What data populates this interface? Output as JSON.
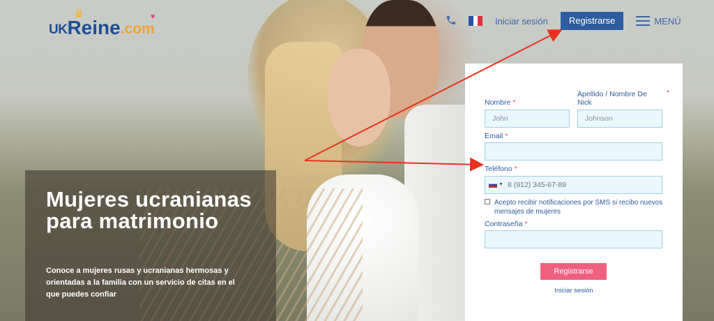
{
  "header": {
    "logo": {
      "uk": "UK",
      "reine": "Reine",
      "com": ".com"
    },
    "login_label": "Iniciar sesión",
    "register_label": "Registrarse",
    "menu_label": "MENÚ"
  },
  "hero": {
    "title": "Mujeres ucranianas para matrimonio",
    "description": "Conoce a mujeres rusas y ucranianas hermosas y orientadas a la familia con un servicio de citas en el que puedes confiar"
  },
  "form": {
    "first_name_label": "Nombre",
    "first_name_placeholder": "John",
    "last_name_label": "Apellido / Nombre De Nick",
    "last_name_placeholder": "Johnson",
    "email_label": "Email",
    "phone_label": "Teléfono",
    "phone_placeholder": "8 (912) 345-67-89",
    "sms_consent": "Acepto recibir notificaciones por SMS si recibo nuevos mensajes de mujeres",
    "password_label": "Contraseña",
    "required_mark": "*",
    "submit_label": "Registrarse",
    "login_label": "Iniciar sesión"
  },
  "colors": {
    "brand_blue": "#2f5c9e",
    "accent_pink": "#ef5f7e",
    "arrow_red": "#e8321e"
  },
  "icons": [
    "phone-icon",
    "flag-france-icon",
    "menu-icon",
    "flag-russia-icon"
  ]
}
